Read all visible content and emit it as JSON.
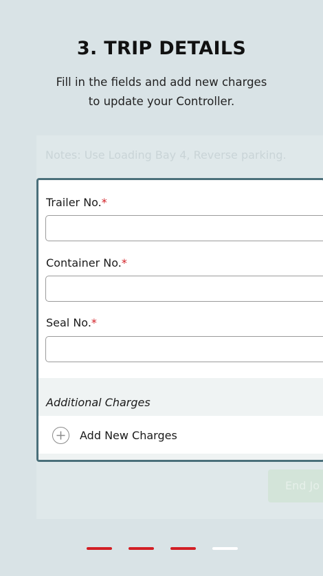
{
  "header": {
    "title": "3. TRIP DETAILS",
    "subtitle_line1": "Fill in the fields and add new charges",
    "subtitle_line2": "to update your Controller."
  },
  "background": {
    "notes": "Notes: Use Loading Bay 4, Reverse parking.",
    "end_button": "End Jo"
  },
  "form": {
    "trailer": {
      "label": "Trailer No.",
      "required_mark": "*",
      "value": ""
    },
    "container": {
      "label": "Container No.",
      "required_mark": "*",
      "value": ""
    },
    "seal": {
      "label": "Seal No.",
      "required_mark": "*",
      "value": ""
    }
  },
  "charges": {
    "section_title": "Additional Charges",
    "add_label": "Add New Charges",
    "add_icon": "plus-circle-icon"
  },
  "pagination": {
    "total": 4,
    "active_count": 3,
    "active_color": "#d21f25",
    "inactive_color": "#ffffff"
  },
  "colors": {
    "background": "#d9e3e6",
    "panel_border": "#4a6f7a",
    "required": "#d21f25"
  }
}
